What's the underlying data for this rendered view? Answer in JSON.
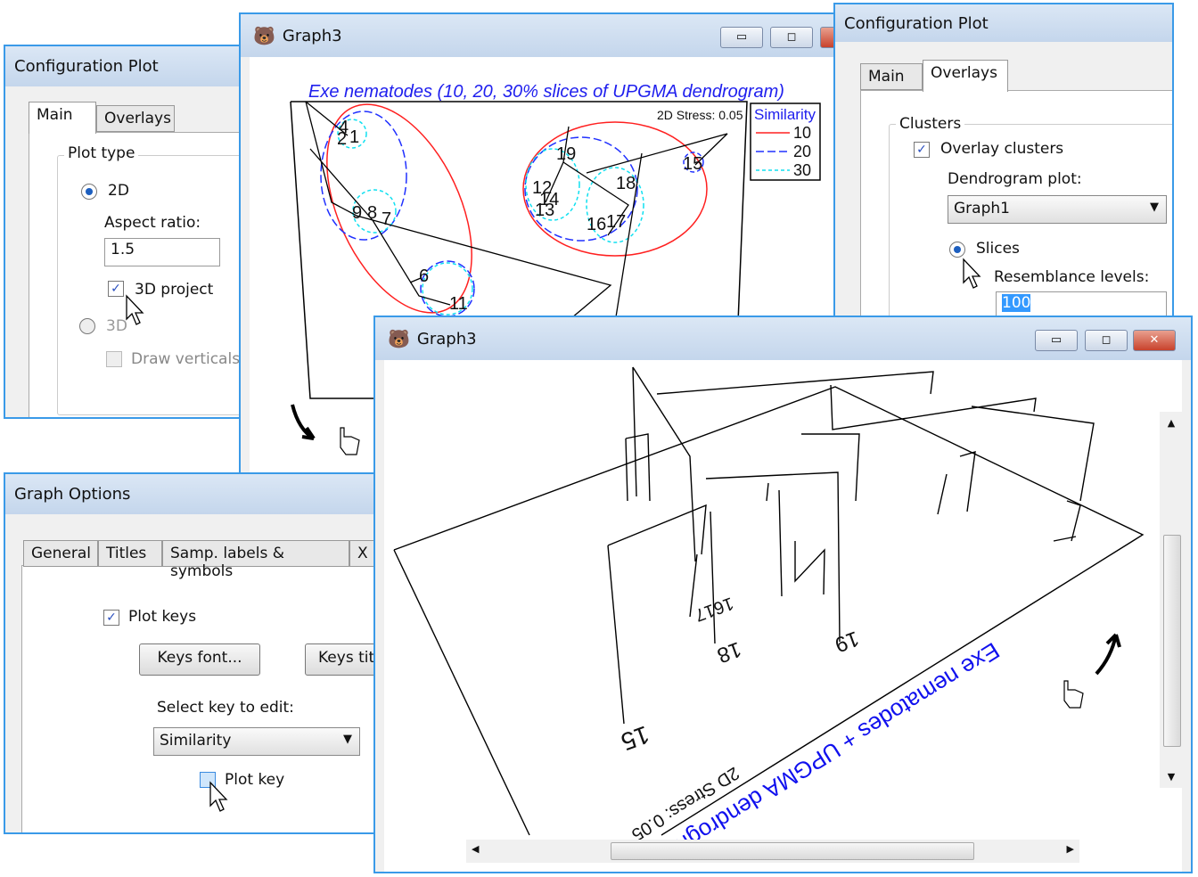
{
  "config_left": {
    "title": "Configuration Plot",
    "tabs": [
      "Main",
      "Overlays"
    ],
    "group": "Plot type",
    "opt_2d": "2D",
    "aspect_label": "Aspect ratio:",
    "aspect_value": "1.5",
    "project_3d": "3D project",
    "project_3d_checked": true,
    "opt_3d": "3D",
    "draw_verticals": "Draw verticals",
    "selected": "2D"
  },
  "graph_top": {
    "title": "Graph3",
    "plot_title": "Exe nematodes (10, 20, 30% slices of UPGMA dendrogram)",
    "stress": "2D Stress: 0.05",
    "legend": {
      "title": "Similarity",
      "items": [
        {
          "label": "10",
          "color": "#ff2020",
          "style": "solid"
        },
        {
          "label": "20",
          "color": "#2030ff",
          "style": "dashed"
        },
        {
          "label": "30",
          "color": "#10e0f0",
          "style": "dotted"
        }
      ]
    },
    "labels": [
      "4",
      "2",
      "1",
      "9",
      "8",
      "7",
      "6",
      "11",
      "19",
      "12",
      "14",
      "13",
      "18",
      "16",
      "17",
      "15"
    ]
  },
  "config_right": {
    "title": "Configuration Plot",
    "tabs": [
      "Main",
      "Overlays"
    ],
    "group": "Clusters",
    "overlay": "Overlay clusters",
    "overlay_checked": true,
    "dendro_label": "Dendrogram plot:",
    "dendro_value": "Graph1",
    "slices": "Slices",
    "resemblance_label": "Resemblance levels:",
    "resemblance_value": "100"
  },
  "graph_options": {
    "title": "Graph Options",
    "tabs": [
      "General",
      "Titles",
      "Samp. labels & symbols",
      "X a"
    ],
    "plot_keys": "Plot keys",
    "plot_keys_checked": true,
    "keys_font": "Keys font...",
    "keys_title": "Keys tit",
    "select_key_label": "Select key to edit:",
    "select_key_value": "Similarity",
    "plot_key": "Plot key",
    "plot_key_checked": false
  },
  "graph_bottom": {
    "title": "Graph3",
    "plot_title": "Exe nematodes + UPGMA dendrogram",
    "stress": "2D Stress: 0.05",
    "labels": [
      "15",
      "18",
      "19",
      "1617"
    ]
  },
  "accent": "#3a9ae8"
}
